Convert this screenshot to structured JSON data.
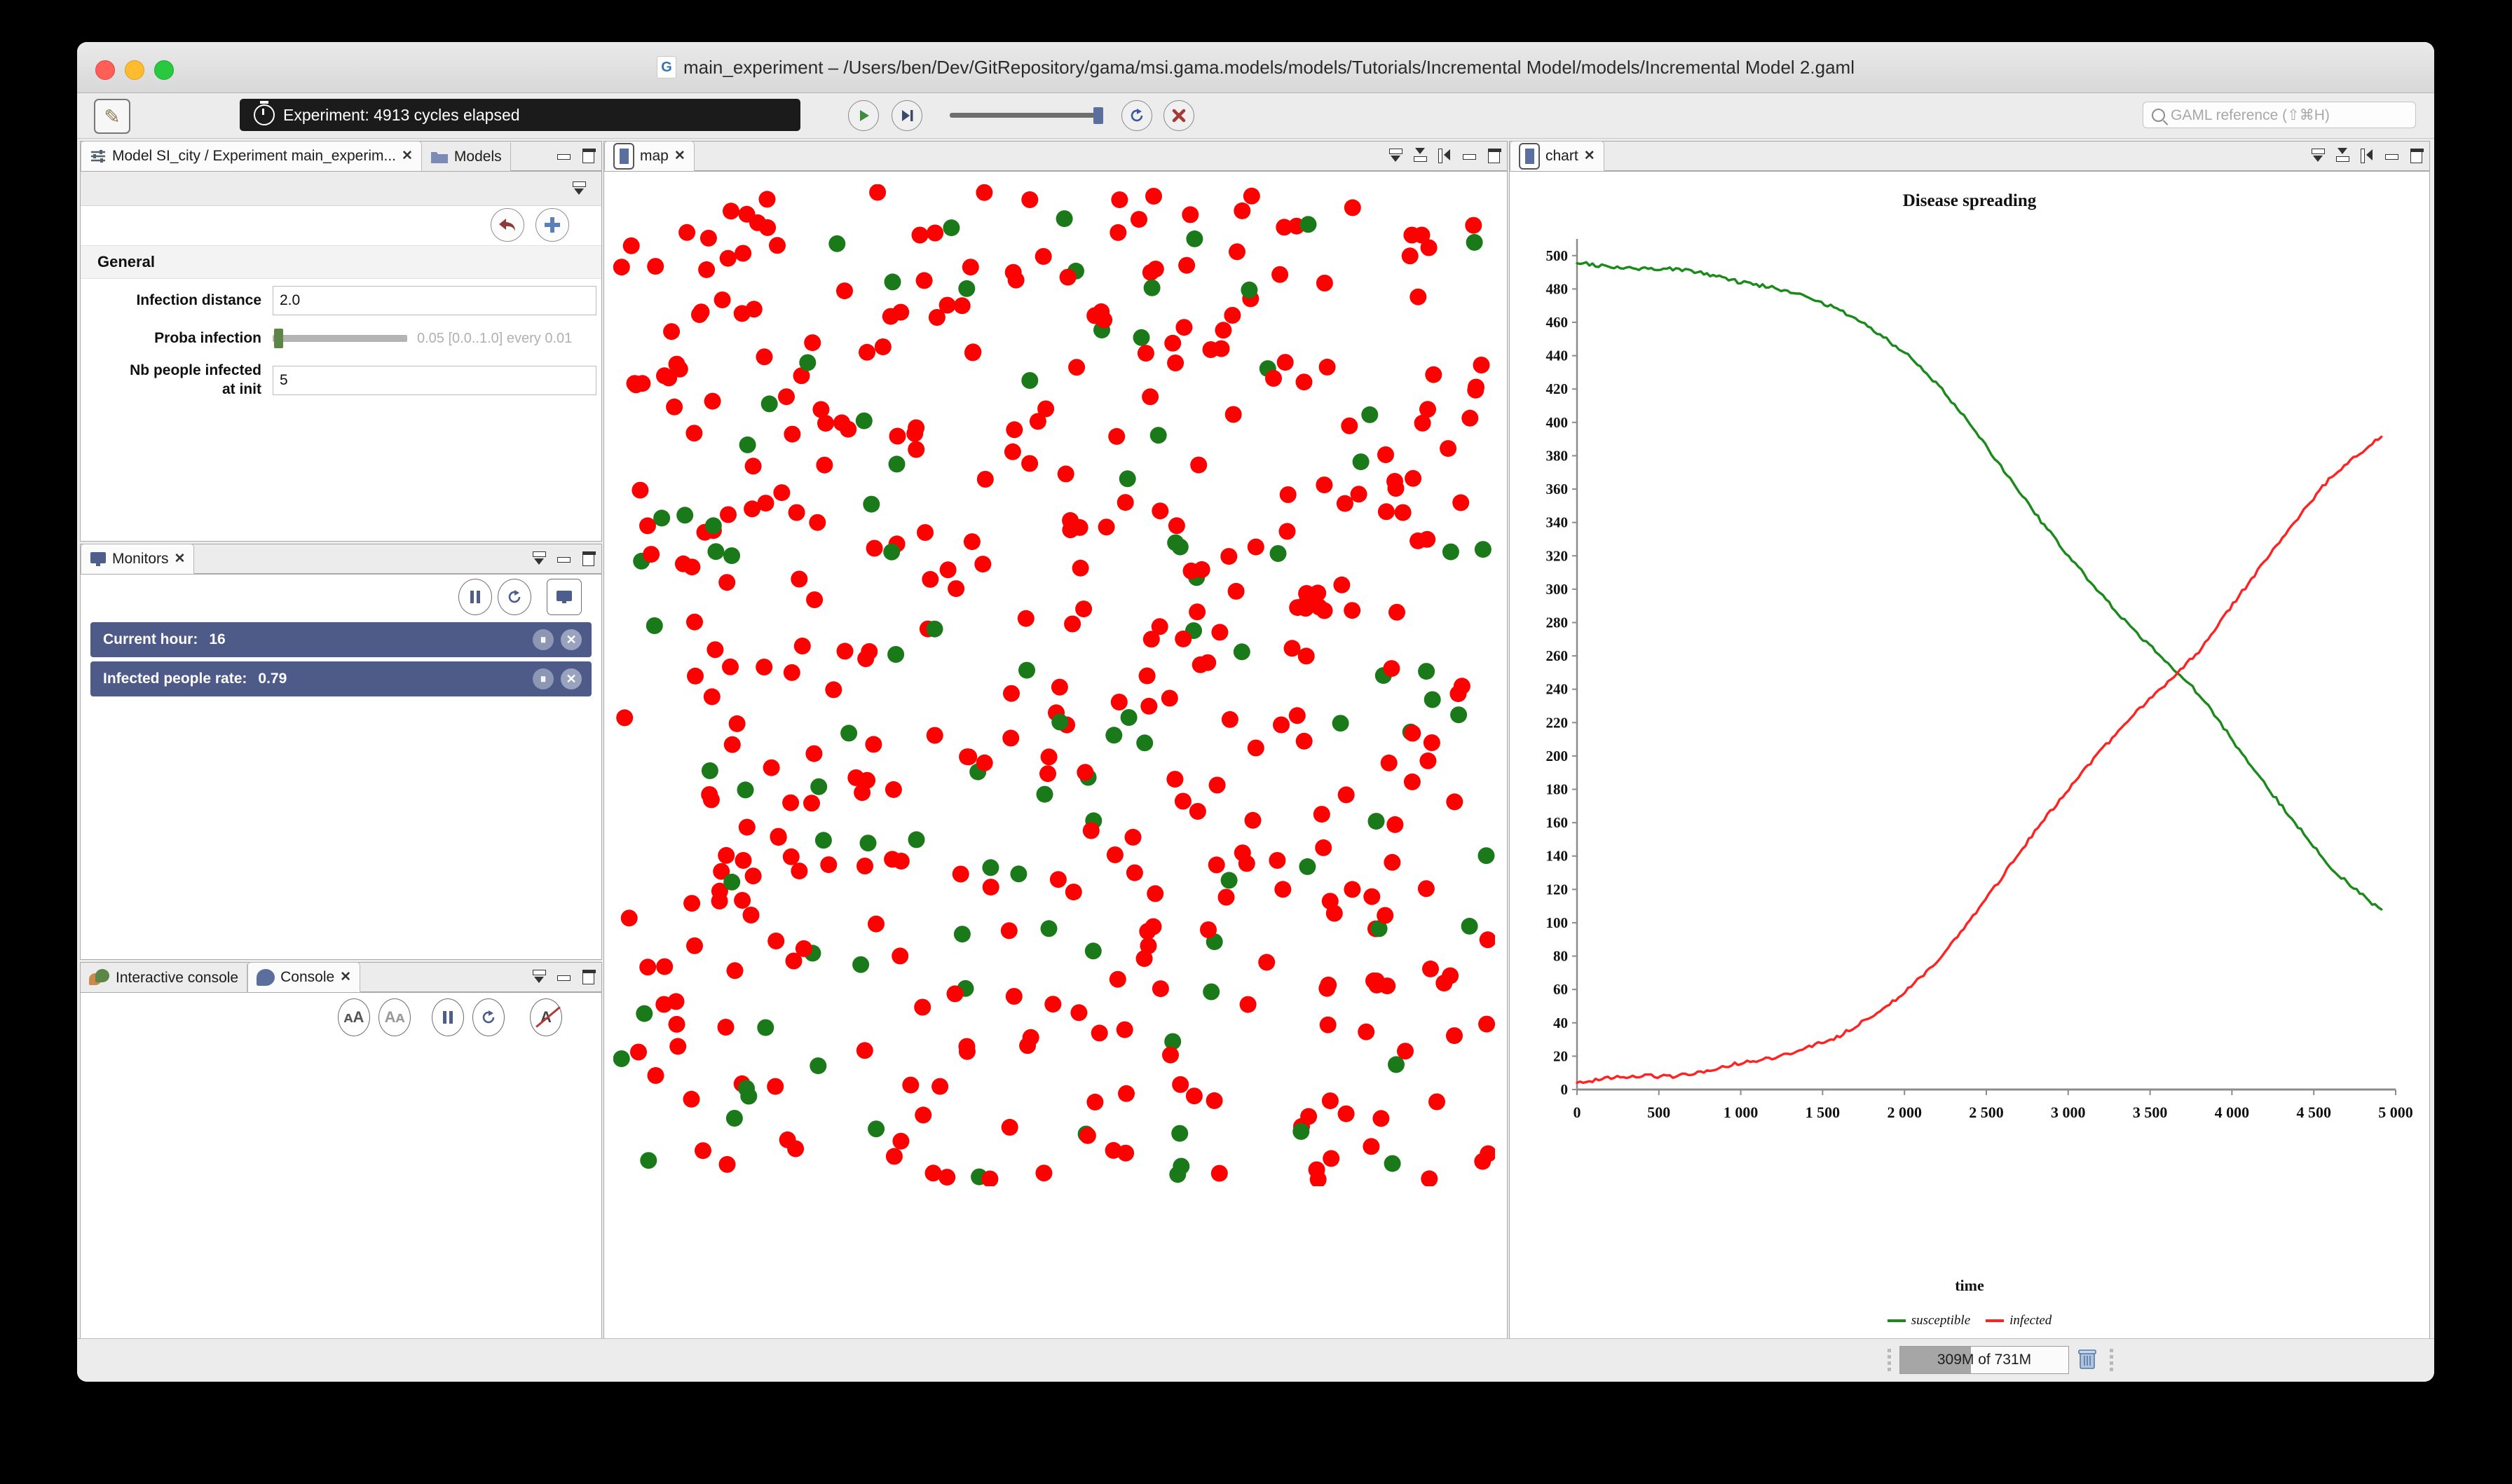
{
  "window": {
    "title": "main_experiment – /Users/ben/Dev/GitRepository/gama/msi.gama.models/models/Tutorials/Incremental Model/models/Incremental Model 2.gaml",
    "logo_icon": "gama-logo-icon",
    "traffic": {
      "close": "close-window-button",
      "minimize": "minimize-window-button",
      "zoom": "zoom-window-button"
    }
  },
  "toolbar": {
    "edit_icon": "pencil-edit-icon",
    "status": "Experiment: 4913 cycles elapsed",
    "clock_icon": "stopwatch-icon",
    "play_icon": "play-icon",
    "step_icon": "step-forward-icon",
    "reload_icon": "reload-icon",
    "stop_icon": "stop-close-icon",
    "slider_label": "speed-slider",
    "search_placeholder": "GAML reference (⇧⌘H)",
    "search_value": "",
    "search_icon": "search-icon"
  },
  "parameters_panel": {
    "tabs": [
      {
        "label": "Model SI_city / Experiment main_experim...",
        "icon": "sliders-icon",
        "active": true,
        "close": "✕"
      },
      {
        "label": "Models",
        "icon": "folder-icon",
        "active": false
      }
    ],
    "revert_icon": "revert-arrow-icon",
    "add_icon": "plus-icon",
    "section": "General",
    "rows": [
      {
        "label": "Infection distance",
        "type": "text",
        "value": "2.0"
      },
      {
        "label": "Proba infection",
        "type": "slider",
        "value": "0.05",
        "range_text": "0.05 [0.0..1.0] every 0.01"
      },
      {
        "label": "Nb people infected\nat init",
        "type": "text",
        "value": "5"
      }
    ]
  },
  "monitors_panel": {
    "tab": {
      "label": "Monitors",
      "icon": "monitor-icon",
      "close": "✕"
    },
    "actions": {
      "pause_icon": "pause-icon",
      "sync_icon": "refresh-icon",
      "display_icon": "display-icon"
    },
    "rows": [
      {
        "label": "Current hour:",
        "value": "16"
      },
      {
        "label": "Infected people rate:",
        "value": "0.79"
      }
    ],
    "row_pause_icon": "pause-icon",
    "row_close_icon": "close-icon"
  },
  "console_panel": {
    "tabs": [
      {
        "label": "Interactive console",
        "icon": "chat-bubbles-icon",
        "active": false
      },
      {
        "label": "Console",
        "icon": "chat-bubble-icon",
        "active": true,
        "close": "✕"
      }
    ],
    "actions": {
      "increase_font_icon": "increase-font-icon",
      "decrease_font_icon": "decrease-font-icon",
      "pause_icon": "pause-icon",
      "sync_icon": "refresh-icon",
      "clear_icon": "clear-text-icon"
    },
    "content": ""
  },
  "map_panel": {
    "tab": {
      "label": "map",
      "icon": "display-square-icon",
      "close": "✕"
    },
    "agent_colors": {
      "susceptible": "#1a7a1a",
      "infected": "#FF0000"
    },
    "background": "#FFFFFF"
  },
  "chart_panel": {
    "tab": {
      "label": "chart",
      "icon": "display-square-icon",
      "close": "✕"
    }
  },
  "statusbar": {
    "heap": "309M of 731M",
    "heap_used_pct": 42,
    "trash_icon": "trash-icon"
  },
  "chart_data": {
    "type": "line",
    "title": "Disease spreading",
    "xlabel": "time",
    "ylabel": "",
    "xlim": [
      0,
      5000
    ],
    "ylim": [
      0,
      510
    ],
    "xticks": [
      0,
      500,
      1000,
      1500,
      2000,
      2500,
      3000,
      3500,
      4000,
      4500,
      5000
    ],
    "xticklabels": [
      "0",
      "500",
      "1 000",
      "1 500",
      "2 000",
      "2 500",
      "3 000",
      "3 500",
      "4 000",
      "4 500",
      "5 000"
    ],
    "yticks": [
      0,
      20,
      40,
      60,
      80,
      100,
      120,
      140,
      160,
      180,
      200,
      220,
      240,
      260,
      280,
      300,
      320,
      340,
      360,
      380,
      400,
      420,
      440,
      460,
      480,
      500
    ],
    "grid": false,
    "legend_position": "bottom",
    "series": [
      {
        "name": "susceptible",
        "color": "#1a8a1a",
        "x": [
          0,
          200,
          400,
          600,
          800,
          1000,
          1200,
          1400,
          1600,
          1800,
          2000,
          2200,
          2400,
          2600,
          2800,
          3000,
          3200,
          3400,
          3600,
          3800,
          4000,
          4200,
          4400,
          4600,
          4913
        ],
        "values": [
          496,
          493,
          492,
          492,
          489,
          484,
          481,
          475,
          468,
          456,
          442,
          423,
          399,
          372,
          345,
          320,
          297,
          275,
          257,
          237,
          210,
          183,
          158,
          133,
          107
        ]
      },
      {
        "name": "infected",
        "color": "#ff2222",
        "x": [
          0,
          200,
          400,
          600,
          800,
          1000,
          1200,
          1400,
          1600,
          1800,
          2000,
          2200,
          2400,
          2600,
          2800,
          3000,
          3200,
          3400,
          3600,
          3800,
          4000,
          4200,
          4400,
          4600,
          4913
        ],
        "values": [
          4,
          7,
          8,
          8,
          11,
          16,
          19,
          25,
          32,
          44,
          58,
          77,
          101,
          128,
          155,
          180,
          203,
          225,
          243,
          263,
          290,
          317,
          342,
          367,
          392
        ]
      }
    ]
  }
}
